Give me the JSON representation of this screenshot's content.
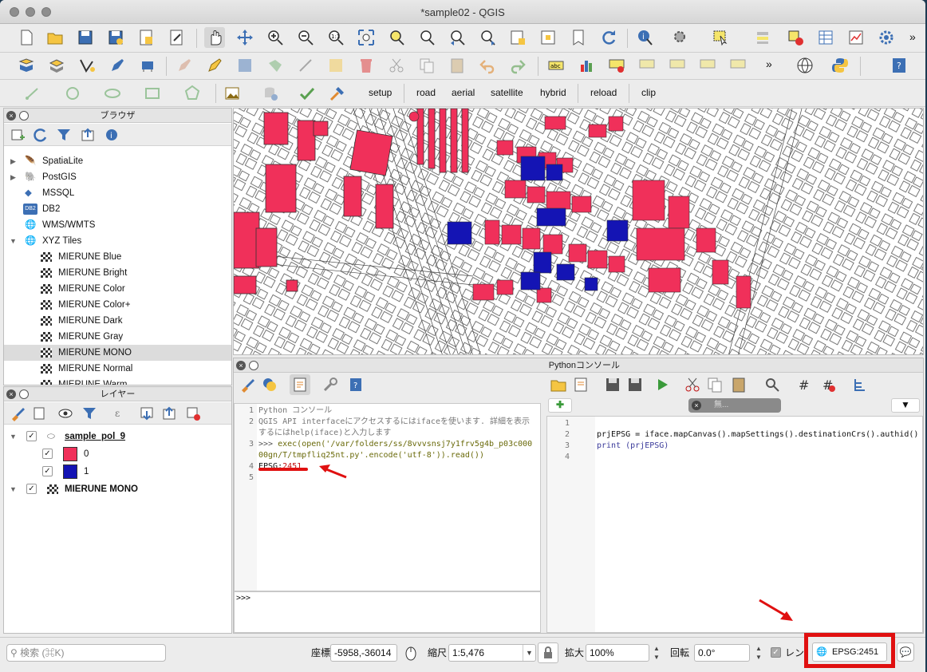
{
  "window": {
    "title": "*sample02 - QGIS"
  },
  "plugin_toolbar": {
    "setup": "setup",
    "road": "road",
    "aerial": "aerial",
    "satellite": "satellite",
    "hybrid": "hybrid",
    "reload": "reload",
    "clip": "clip"
  },
  "browser": {
    "title": "ブラウザ",
    "items": [
      {
        "label": "SpatiaLite",
        "icon": "feather-icon"
      },
      {
        "label": "PostGIS",
        "icon": "elephant-icon"
      },
      {
        "label": "MSSQL",
        "icon": "mssql-icon"
      },
      {
        "label": "DB2",
        "icon": "db2-icon"
      },
      {
        "label": "WMS/WMTS",
        "icon": "globe-icon"
      },
      {
        "label": "XYZ Tiles",
        "icon": "globe-icon"
      }
    ],
    "xyz_children": [
      "MIERUNE Blue",
      "MIERUNE Bright",
      "MIERUNE Color",
      "MIERUNE Color+",
      "MIERUNE Dark",
      "MIERUNE Gray",
      "MIERUNE MONO",
      "MIERUNE Normal",
      "MIERUNE Warm"
    ]
  },
  "layers": {
    "title": "レイヤー",
    "group": "sample_pol_9",
    "classes": [
      {
        "label": "0",
        "color": "#f0305a"
      },
      {
        "label": "1",
        "color": "#1414b4"
      }
    ],
    "basemap": "MIERUNE MONO"
  },
  "python_console": {
    "title": "Pythonコンソール",
    "lines": [
      {
        "n": "1",
        "text": "Python コンソール"
      },
      {
        "n": "2",
        "text": "QGIS API interfaceにアクセスするにはifaceを使います. 詳細を表示するにはhelp(iface)と入力します"
      },
      {
        "n": "3",
        "prompt": ">>> ",
        "code": "exec(open('/var/folders/ss/8vvvsnsj7y1frv5g4b_p03c00000gn/T/tmpfliq25nt.py'.encode('utf-8')).read())"
      },
      {
        "n": "4",
        "key": "EPSG:",
        "val": "2451"
      },
      {
        "n": "5",
        "text": ""
      }
    ],
    "input_prompt": ">>>",
    "editor_tab": "無...",
    "editor_lines": [
      {
        "n": "1",
        "text": ""
      },
      {
        "n": "2",
        "text": "prjEPSG = iface.mapCanvas().mapSettings().destinationCrs().authid()"
      },
      {
        "n": "3",
        "text": "print (prjEPSG)"
      },
      {
        "n": "4",
        "text": ""
      }
    ]
  },
  "status": {
    "search_placeholder": "検索 (⌘K)",
    "coord_label": "座標",
    "coord_value": "-5958,-36014",
    "scale_label": "縮尺",
    "scale_value": "1:5,476",
    "magnify_label": "拡大",
    "magnify_value": "100%",
    "rotation_label": "回転",
    "rotation_value": "0.0°",
    "render_label": "レンダ",
    "crs": "EPSG:2451"
  },
  "colors": {
    "class0": "#f0305a",
    "class1": "#1414b4",
    "highlight": "#e01010"
  }
}
